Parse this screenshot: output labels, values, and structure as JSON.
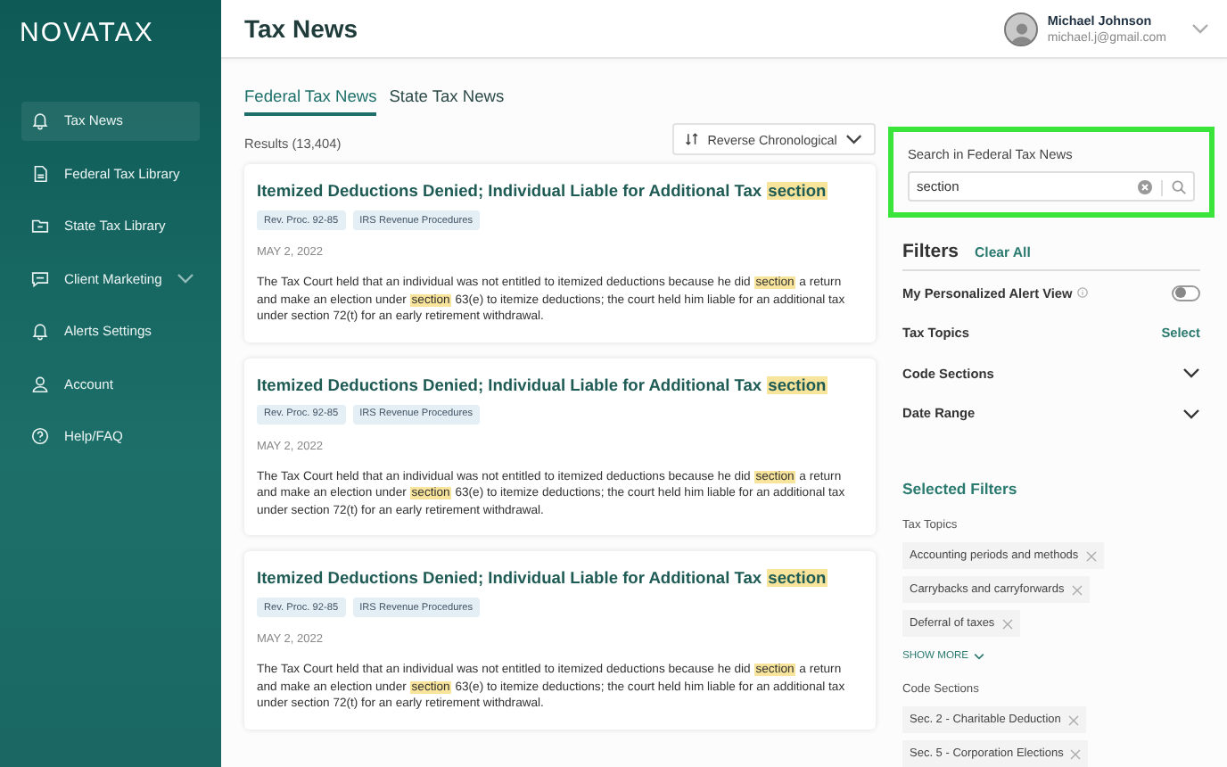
{
  "brand": {
    "logo": "NOVATAX"
  },
  "sidebar": {
    "items": [
      {
        "label": "Tax News",
        "kind": "bell",
        "selected": true,
        "expandable": false
      },
      {
        "label": "Federal Tax Library",
        "kind": "document",
        "selected": false,
        "expandable": false
      },
      {
        "label": "State Tax Library",
        "kind": "folder",
        "selected": false,
        "expandable": false
      },
      {
        "label": "Client Marketing",
        "kind": "chat",
        "selected": false,
        "expandable": true
      },
      {
        "label": "Alerts Settings",
        "kind": "bell",
        "selected": false,
        "expandable": false
      },
      {
        "label": "Account",
        "kind": "person",
        "selected": false,
        "expandable": false
      },
      {
        "label": "Help/FAQ",
        "kind": "help",
        "selected": false,
        "expandable": false
      }
    ]
  },
  "header": {
    "title": "Tax News",
    "user": {
      "name": "Michael Johnson",
      "email": "michael.j@gmail.com"
    }
  },
  "tabs": [
    {
      "label": "Federal Tax News",
      "selected": true
    },
    {
      "label": "State Tax News",
      "selected": false
    }
  ],
  "results": "Results (13,404)",
  "sort": "Reverse Chronological",
  "articles": [
    {
      "title": [
        {
          "text": "Itemized Deductions Denied; Individual Liable for Additional Tax ",
          "highlighted": false
        },
        {
          "text": "section",
          "highlighted": true
        }
      ],
      "tags": [
        "Rev. Proc. 92-85",
        "IRS Revenue Procedures"
      ],
      "date": "MAY 2, 2022",
      "summary": [
        {
          "text": "The Tax Court held that an individual was not entitled to itemized deductions because he did ",
          "highlighted": false
        },
        {
          "text": "section",
          "highlighted": true
        },
        {
          "text": " a return and make an election under ",
          "highlighted": false
        },
        {
          "text": "section",
          "highlighted": true
        },
        {
          "text": " 63(e) to itemize deductions; the court held him liable for an additional tax under section 72(t) for an early retirement withdrawal.",
          "highlighted": false
        }
      ]
    },
    {
      "title": [
        {
          "text": "Itemized Deductions Denied; Individual Liable for Additional Tax ",
          "highlighted": false
        },
        {
          "text": "section",
          "highlighted": true
        }
      ],
      "tags": [
        "Rev. Proc. 92-85",
        "IRS Revenue Procedures"
      ],
      "date": "MAY 2, 2022",
      "summary": [
        {
          "text": "The Tax Court held that an individual was not entitled to itemized deductions because he did ",
          "highlighted": false
        },
        {
          "text": "section",
          "highlighted": true
        },
        {
          "text": " a return and make an election under ",
          "highlighted": false
        },
        {
          "text": "section",
          "highlighted": true
        },
        {
          "text": " 63(e) to itemize deductions; the court held him liable for an additional tax under section 72(t) for an early retirement withdrawal.",
          "highlighted": false
        }
      ]
    },
    {
      "title": [
        {
          "text": "Itemized Deductions Denied; Individual Liable for Additional Tax ",
          "highlighted": false
        },
        {
          "text": "section",
          "highlighted": true
        }
      ],
      "tags": [
        "Rev. Proc. 92-85",
        "IRS Revenue Procedures"
      ],
      "date": "MAY 2, 2022",
      "summary": [
        {
          "text": "The Tax Court held that an individual was not entitled to itemized deductions because he did ",
          "highlighted": false
        },
        {
          "text": "section",
          "highlighted": true
        },
        {
          "text": " a return and make an election under ",
          "highlighted": false
        },
        {
          "text": "section",
          "highlighted": true
        },
        {
          "text": " 63(e) to itemize deductions; the court held him liable for an additional tax under section 72(t) for an early retirement withdrawal.",
          "highlighted": false
        }
      ]
    }
  ],
  "search": {
    "label": "Search in Federal Tax News",
    "value": "section",
    "outlined": true
  },
  "filters": {
    "title": "Filters",
    "clear": "Clear All",
    "rows": [
      {
        "kind": "toggle",
        "label": "My Personalized Alert View",
        "on": false
      },
      {
        "kind": "select",
        "label": "Tax Topics",
        "action": "Select"
      },
      {
        "kind": "expand",
        "label": "Code Sections",
        "expanded": false
      },
      {
        "kind": "expand",
        "label": "Date Range",
        "expanded": false
      }
    ]
  },
  "selected_filters": {
    "title": "Selected Filters",
    "groups": [
      {
        "label": "Tax Topics",
        "chips": [
          "Accounting periods and methods",
          "Carrybacks and carryforwards",
          "Deferral of taxes"
        ],
        "more": "SHOW MORE"
      },
      {
        "label": "Code Sections",
        "chips": [
          "Sec. 2 - Charitable Deduction",
          "Sec. 5 - Corporation Elections"
        ]
      }
    ]
  }
}
